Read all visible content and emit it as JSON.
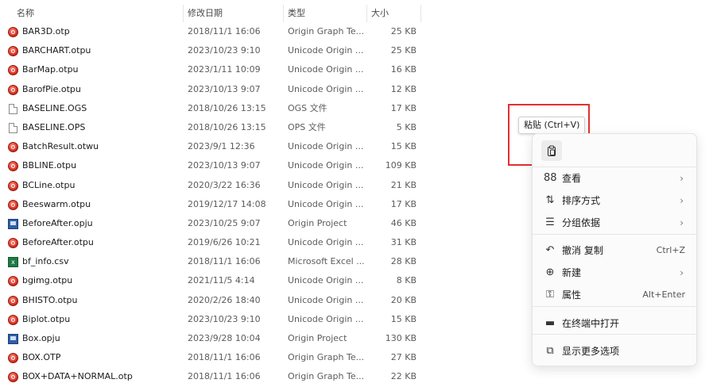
{
  "columns": {
    "name": "名称",
    "date": "修改日期",
    "type": "类型",
    "size": "大小"
  },
  "files": [
    {
      "icon": "origin-template-icon",
      "kind": "otp",
      "name": "BAR3D.otp",
      "date": "2018/11/1 16:06",
      "type": "Origin Graph Te...",
      "size": "25 KB"
    },
    {
      "icon": "origin-template-icon",
      "kind": "otp",
      "name": "BARCHART.otpu",
      "date": "2023/10/23 9:10",
      "type": "Unicode Origin ...",
      "size": "25 KB"
    },
    {
      "icon": "origin-template-icon",
      "kind": "otp",
      "name": "BarMap.otpu",
      "date": "2023/1/11 10:09",
      "type": "Unicode Origin ...",
      "size": "16 KB"
    },
    {
      "icon": "origin-template-icon",
      "kind": "otp",
      "name": "BarofPie.otpu",
      "date": "2023/10/13 9:07",
      "type": "Unicode Origin ...",
      "size": "12 KB"
    },
    {
      "icon": "blank-file-icon",
      "kind": "file",
      "name": "BASELINE.OGS",
      "date": "2018/10/26 13:15",
      "type": "OGS 文件",
      "size": "17 KB"
    },
    {
      "icon": "blank-file-icon",
      "kind": "file",
      "name": "BASELINE.OPS",
      "date": "2018/10/26 13:15",
      "type": "OPS 文件",
      "size": "5 KB"
    },
    {
      "icon": "origin-template-icon",
      "kind": "otp",
      "name": "BatchResult.otwu",
      "date": "2023/9/1 12:36",
      "type": "Unicode Origin ...",
      "size": "15 KB"
    },
    {
      "icon": "origin-template-icon",
      "kind": "otp",
      "name": "BBLINE.otpu",
      "date": "2023/10/13 9:07",
      "type": "Unicode Origin ...",
      "size": "109 KB"
    },
    {
      "icon": "origin-template-icon",
      "kind": "otp",
      "name": "BCLine.otpu",
      "date": "2020/3/22 16:36",
      "type": "Unicode Origin ...",
      "size": "21 KB"
    },
    {
      "icon": "origin-template-icon",
      "kind": "otp",
      "name": "Beeswarm.otpu",
      "date": "2019/12/17 14:08",
      "type": "Unicode Origin ...",
      "size": "17 KB"
    },
    {
      "icon": "origin-project-icon",
      "kind": "opju",
      "name": "BeforeAfter.opju",
      "date": "2023/10/25 9:07",
      "type": "Origin Project",
      "size": "46 KB"
    },
    {
      "icon": "origin-template-icon",
      "kind": "otp",
      "name": "BeforeAfter.otpu",
      "date": "2019/6/26 10:21",
      "type": "Unicode Origin ...",
      "size": "31 KB"
    },
    {
      "icon": "excel-csv-icon",
      "kind": "csv",
      "name": "bf_info.csv",
      "date": "2018/11/1 16:06",
      "type": "Microsoft Excel ...",
      "size": "28 KB"
    },
    {
      "icon": "origin-template-icon",
      "kind": "otp",
      "name": "bgimg.otpu",
      "date": "2021/11/5 4:14",
      "type": "Unicode Origin ...",
      "size": "8 KB"
    },
    {
      "icon": "origin-template-icon",
      "kind": "otp",
      "name": "BHISTO.otpu",
      "date": "2020/2/26 18:40",
      "type": "Unicode Origin ...",
      "size": "20 KB"
    },
    {
      "icon": "origin-template-icon",
      "kind": "otp",
      "name": "Biplot.otpu",
      "date": "2023/10/23 9:10",
      "type": "Unicode Origin ...",
      "size": "15 KB"
    },
    {
      "icon": "origin-project-icon",
      "kind": "opju",
      "name": "Box.opju",
      "date": "2023/9/28 10:04",
      "type": "Origin Project",
      "size": "130 KB"
    },
    {
      "icon": "origin-template-icon",
      "kind": "otp",
      "name": "BOX.OTP",
      "date": "2018/11/1 16:06",
      "type": "Origin Graph Te...",
      "size": "27 KB"
    },
    {
      "icon": "origin-template-icon",
      "kind": "otp",
      "name": "BOX+DATA+NORMAL.otp",
      "date": "2018/11/1 16:06",
      "type": "Origin Graph Te...",
      "size": "22 KB"
    }
  ],
  "tooltip": {
    "text": "粘贴 (Ctrl+V)"
  },
  "context_menu": {
    "paste_icon": "paste-icon",
    "items": [
      {
        "icon": "view-grid-icon",
        "glyph": "88",
        "label": "查看",
        "shortcut": "",
        "submenu": true
      },
      {
        "icon": "sort-icon",
        "glyph": "⇅",
        "label": "排序方式",
        "shortcut": "",
        "submenu": true
      },
      {
        "icon": "group-icon",
        "glyph": "☰",
        "label": "分组依据",
        "shortcut": "",
        "submenu": true
      },
      {
        "icon": "undo-icon",
        "glyph": "↶",
        "label": "撤消 复制",
        "shortcut": "Ctrl+Z",
        "submenu": false
      },
      {
        "icon": "new-icon",
        "glyph": "⊕",
        "label": "新建",
        "shortcut": "",
        "submenu": true
      },
      {
        "icon": "properties-icon",
        "glyph": "⚿",
        "label": "属性",
        "shortcut": "Alt+Enter",
        "submenu": false
      },
      {
        "icon": "terminal-icon",
        "glyph": "▬",
        "label": "在终端中打开",
        "shortcut": "",
        "submenu": false
      },
      {
        "icon": "more-options-icon",
        "glyph": "⧉",
        "label": "显示更多选项",
        "shortcut": "",
        "submenu": false
      }
    ],
    "chevron": "›"
  },
  "colors": {
    "highlight_border": "#e03030",
    "menu_background": "#fbfbfb"
  }
}
